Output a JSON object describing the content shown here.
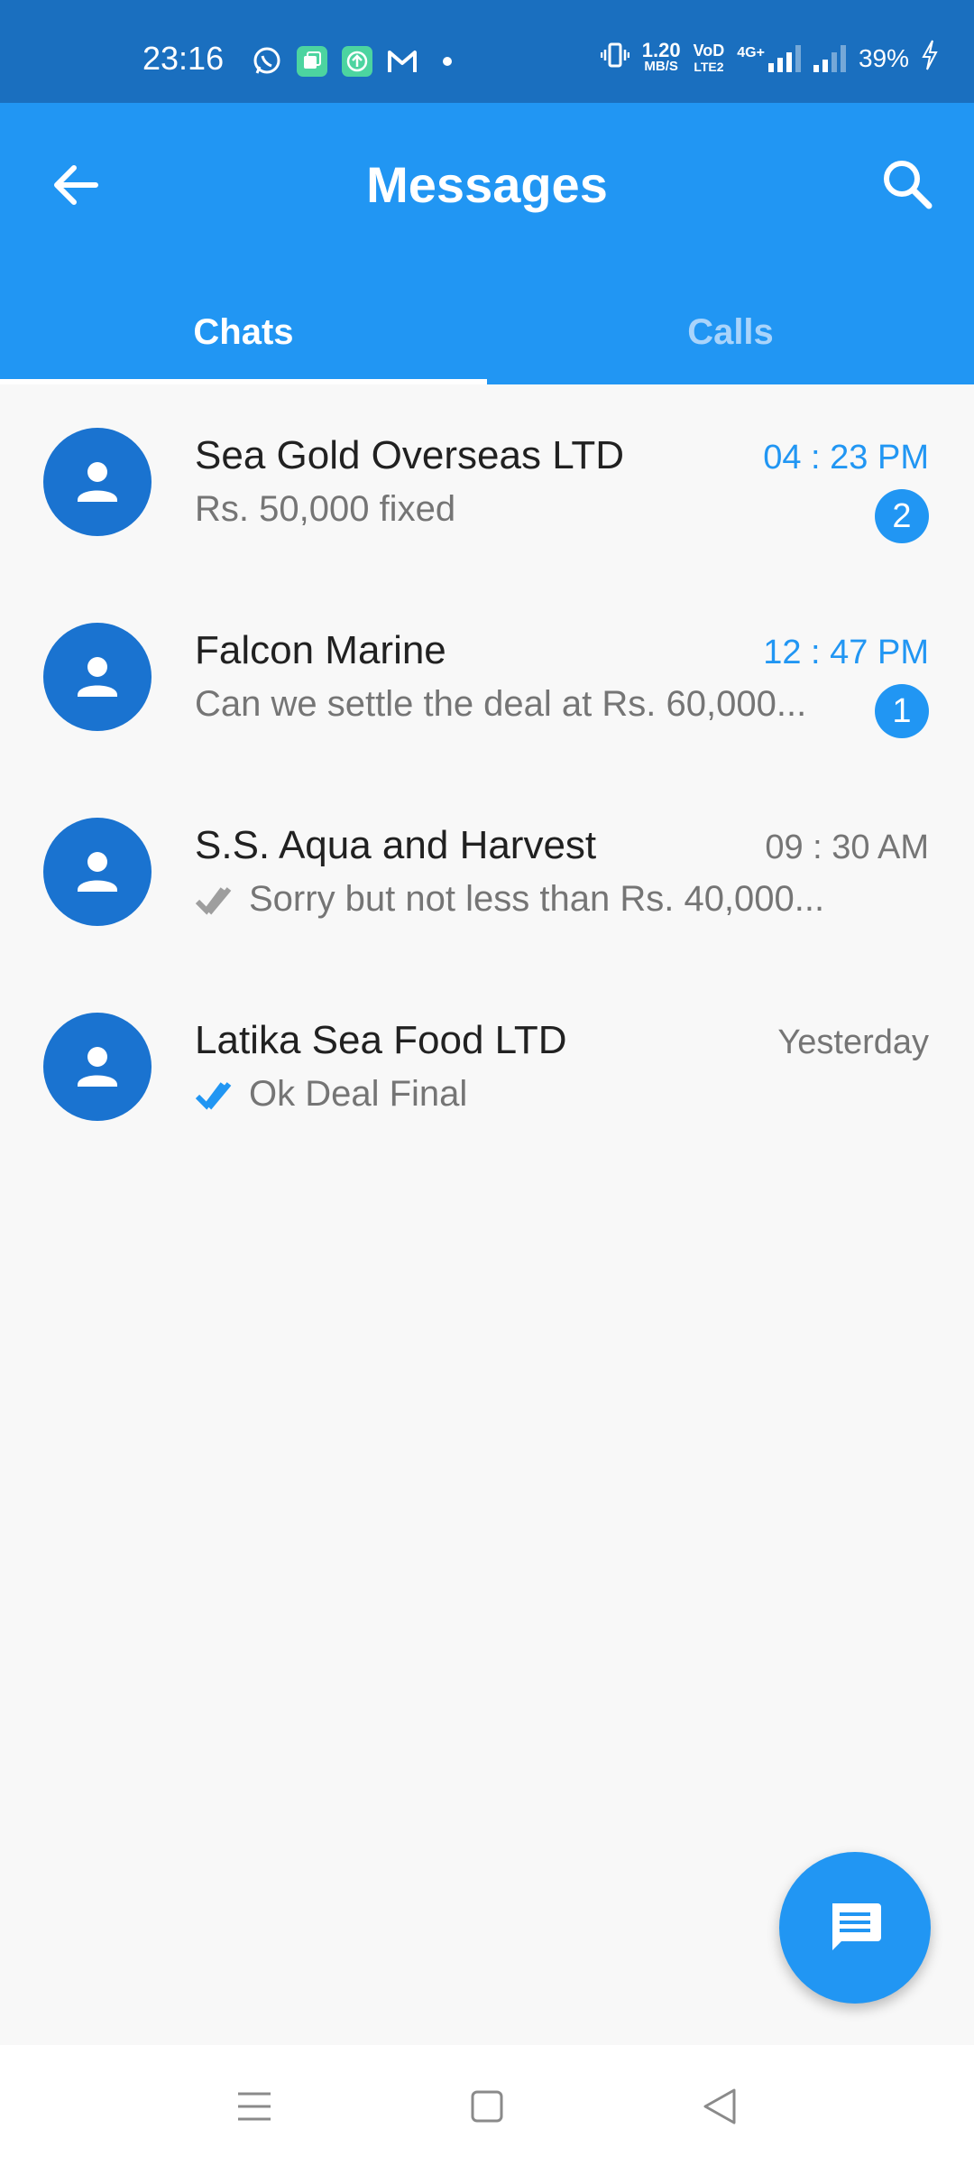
{
  "status_bar": {
    "time": "23:16",
    "net_speed_value": "1.20",
    "net_speed_unit": "MB/S",
    "volte_top": "VoD",
    "volte_bottom": "LTE2",
    "network_type": "4G+",
    "battery": "39%",
    "notification_icons": [
      "whatsapp-icon",
      "copy-app-icon",
      "upload-app-icon",
      "gmail-icon",
      "dot-icon"
    ]
  },
  "app_bar": {
    "title": "Messages"
  },
  "tabs": [
    {
      "label": "Chats",
      "active": true
    },
    {
      "label": "Calls",
      "active": false
    }
  ],
  "chats": [
    {
      "name": "Sea Gold Overseas LTD",
      "preview": "Rs. 50,000 fixed",
      "time": "04 : 23 PM",
      "unread": "2",
      "status": "unread"
    },
    {
      "name": "Falcon Marine",
      "preview": "Can we settle the deal at Rs. 60,000...",
      "time": "12 : 47 PM",
      "unread": "1",
      "status": "unread"
    },
    {
      "name": "S.S. Aqua and Harvest",
      "preview": "Sorry but not less than Rs. 40,000...",
      "time": "09 : 30 AM",
      "status": "delivered"
    },
    {
      "name": "Latika Sea Food LTD",
      "preview": "Ok Deal Final",
      "time": "Yesterday",
      "status": "read"
    }
  ],
  "colors": {
    "status_bar": "#1a6fbf",
    "app_bar": "#2196f3",
    "avatar": "#1a73d0",
    "accent": "#2196f3",
    "delivered_tick": "#9e9e9e",
    "read_tick": "#2196f3"
  }
}
